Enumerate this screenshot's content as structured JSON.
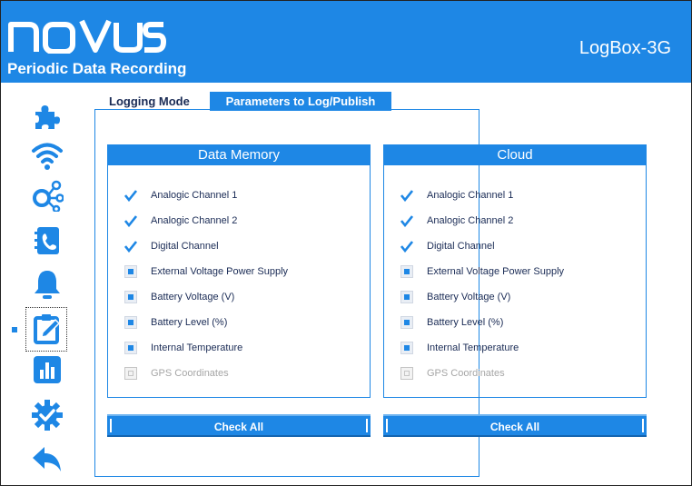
{
  "header": {
    "logo_text": "NOVUS",
    "subtitle": "Periodic Data Recording",
    "device_name": "LogBox-3G",
    "color": "#1e87e5"
  },
  "sidebar": {
    "items": [
      {
        "icon": "puzzle-icon",
        "selected": false
      },
      {
        "icon": "wifi-icon",
        "selected": false
      },
      {
        "icon": "network-nodes-icon",
        "selected": false
      },
      {
        "icon": "contact-book-icon",
        "selected": false
      },
      {
        "icon": "bell-icon",
        "selected": false
      },
      {
        "icon": "edit-clipboard-icon",
        "selected": true
      },
      {
        "icon": "bar-chart-icon",
        "selected": false
      },
      {
        "icon": "gear-check-icon",
        "selected": false
      },
      {
        "icon": "back-arrow-icon",
        "selected": false
      }
    ]
  },
  "tabs": [
    {
      "label": "Logging Mode",
      "active": false
    },
    {
      "label": "Parameters to Log/Publish",
      "active": true
    }
  ],
  "sections": [
    {
      "title": "Data Memory",
      "items": [
        {
          "label": "Analogic Channel 1",
          "state": "checked"
        },
        {
          "label": "Analogic Channel 2",
          "state": "checked"
        },
        {
          "label": "Digital Channel",
          "state": "checked"
        },
        {
          "label": "External Voltage Power Supply",
          "state": "unchecked"
        },
        {
          "label": "Battery Voltage (V)",
          "state": "unchecked"
        },
        {
          "label": "Battery Level (%)",
          "state": "unchecked"
        },
        {
          "label": "Internal Temperature",
          "state": "unchecked"
        },
        {
          "label": "GPS Coordinates",
          "state": "disabled"
        }
      ],
      "button_label": "Check All"
    },
    {
      "title": "Cloud",
      "items": [
        {
          "label": "Analogic Channel 1",
          "state": "checked"
        },
        {
          "label": "Analogic Channel 2",
          "state": "checked"
        },
        {
          "label": "Digital Channel",
          "state": "checked"
        },
        {
          "label": "External Voltage Power Supply",
          "state": "unchecked"
        },
        {
          "label": "Battery Voltage (V)",
          "state": "unchecked"
        },
        {
          "label": "Battery Level (%)",
          "state": "unchecked"
        },
        {
          "label": "Internal Temperature",
          "state": "unchecked"
        },
        {
          "label": "GPS Coordinates",
          "state": "disabled"
        }
      ],
      "button_label": "Check All"
    }
  ]
}
